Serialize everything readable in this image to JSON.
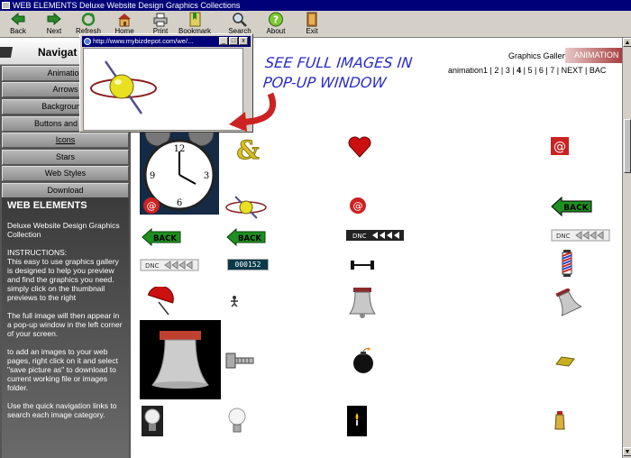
{
  "window": {
    "title": "WEB ELEMENTS Deluxe Website Design Graphics Collections"
  },
  "toolbar": {
    "items": [
      {
        "label": "Back",
        "icon": "back-arrow-icon"
      },
      {
        "label": "Next",
        "icon": "next-arrow-icon"
      },
      {
        "label": "Refresh",
        "icon": "refresh-icon"
      },
      {
        "label": "Home",
        "icon": "home-icon"
      },
      {
        "label": "Print",
        "icon": "printer-icon"
      },
      {
        "label": "Bookmark",
        "icon": "bookmark-icon"
      },
      {
        "label": "Search",
        "icon": "search-icon"
      },
      {
        "label": "About",
        "icon": "about-icon"
      },
      {
        "label": "Exit",
        "icon": "exit-icon"
      }
    ]
  },
  "sidebar": {
    "heading": "Navigat",
    "items": [
      "Animation",
      "Arrows",
      "Backgrounds",
      "Buttons and Bars",
      "Icons",
      "Stars",
      "Web Styles",
      "Download"
    ],
    "active": "Icons",
    "info": {
      "title": "WEB ELEMENTS",
      "subtitle": "Deluxe Website Design Graphics Collection",
      "instructions_label": "INSTRUCTIONS:",
      "instructions": "This easy to use graphics gallery is designed to help you preview and find the graphics you need. simply click on the thumbnail previews to the right",
      "p2": "The full image will then appear in a pop-up window in the left corner of your screen.",
      "p3": "to add an images to your web pages, right click on it and select \"save picture as\" to download to current working file or images folder.",
      "p4": "Use the quick navigation links to search each image category."
    }
  },
  "gallery": {
    "label": "Graphics Gallery :",
    "current_tab": "ANIMATION",
    "pager": {
      "prefix": "animation1",
      "pages": [
        "2",
        "3",
        "4",
        "5",
        "6",
        "7"
      ],
      "current": "4",
      "next": "NEXT",
      "back": "BAC"
    }
  },
  "popup": {
    "url": "http://www.mybizdepot.com/we/..."
  },
  "callout": {
    "line1": "SEE FULL IMAGES IN",
    "line2": "POP-UP WINDOW"
  },
  "thumbs": [
    {
      "name": "clock-thumbnail"
    },
    {
      "name": "ampersand-thumbnail"
    },
    {
      "name": "red-heart-thumbnail"
    },
    {
      "name": "at-sign-red-thumbnail"
    },
    {
      "name": "at-sign-small-thumbnail"
    },
    {
      "name": "atom-thumbnail"
    },
    {
      "name": "at-sign-small2-thumbnail"
    },
    {
      "name": "green-back-button-thumbnail"
    },
    {
      "name": "green-back-arrow-thumbnail"
    },
    {
      "name": "green-back-arrow2-thumbnail"
    },
    {
      "name": "dna-arrows-dark-thumbnail"
    },
    {
      "name": "dna-arrows-light-thumbnail"
    },
    {
      "name": "dna-arrows-light2-thumbnail"
    },
    {
      "name": "counter-thumbnail",
      "text": "000152"
    },
    {
      "name": "barbell-thumbnail"
    },
    {
      "name": "barber-pole-thumbnail"
    },
    {
      "name": "red-umbrella-thumbnail"
    },
    {
      "name": "small-figure-thumbnail"
    },
    {
      "name": "bell-small-thumbnail"
    },
    {
      "name": "bell-swing-thumbnail"
    },
    {
      "name": "bell-large-thumbnail"
    },
    {
      "name": "bolt-thumbnail"
    },
    {
      "name": "bomb-thumbnail"
    },
    {
      "name": "gold-bar-thumbnail"
    },
    {
      "name": "bulb-dark-thumbnail"
    },
    {
      "name": "bulb-light-thumbnail"
    },
    {
      "name": "candle-thumbnail"
    },
    {
      "name": "bottle-thumbnail"
    }
  ],
  "colors": {
    "titlebar": "#000078",
    "sidebar": "#555555",
    "callout": "#2a2acc",
    "arrow": "#cc2222"
  }
}
